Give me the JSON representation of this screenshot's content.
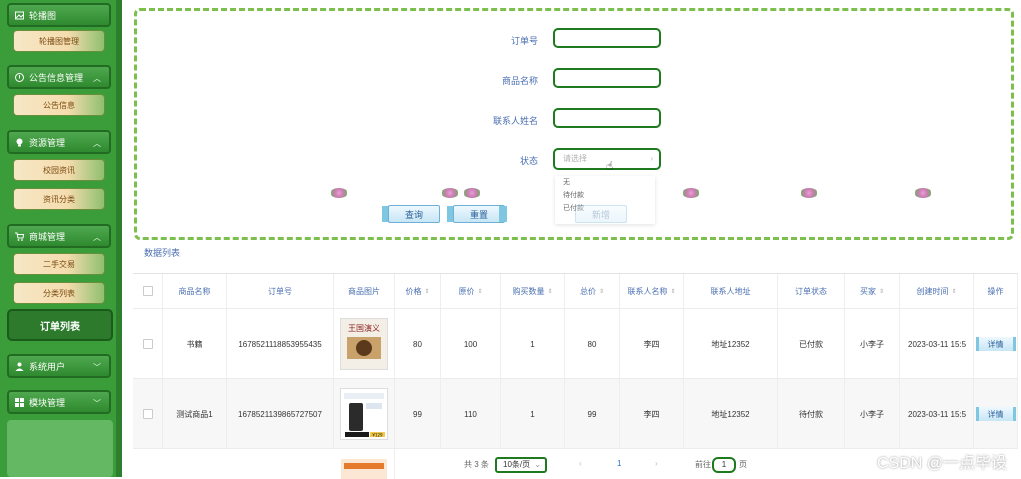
{
  "sidebar": {
    "items": [
      {
        "label": "轮播图",
        "icon": "image-icon"
      },
      {
        "label": "轮播图管理"
      },
      {
        "label": "公告信息管理",
        "icon": "info-icon"
      },
      {
        "label": "公告信息"
      },
      {
        "label": "资源管理",
        "icon": "bulb-icon"
      },
      {
        "label": "校园资讯"
      },
      {
        "label": "资讯分类"
      },
      {
        "label": "商城管理",
        "icon": "cart-icon"
      },
      {
        "label": "二手交易"
      },
      {
        "label": "分类列表"
      },
      {
        "label": "订单列表"
      },
      {
        "label": "系统用户",
        "icon": "user-icon"
      },
      {
        "label": "模块管理",
        "icon": "grid-icon"
      }
    ]
  },
  "search": {
    "order_no_label": "订单号",
    "product_name_label": "商品名称",
    "contact_name_label": "联系人姓名",
    "status_label": "状态",
    "status_placeholder": "请选择",
    "status_options": [
      "无",
      "待付款",
      "已付款"
    ],
    "query_button": "查询",
    "reset_button": "重置",
    "ghost_button": "新增"
  },
  "list": {
    "title": "数据列表",
    "headers": [
      "商品名称",
      "订单号",
      "商品图片",
      "价格",
      "原价",
      "购买数量",
      "总价",
      "联系人名称",
      "联系人地址",
      "订单状态",
      "买家",
      "创建时间",
      "操作"
    ],
    "rows": [
      {
        "name": "书籍",
        "order_no": "1678521118853955435",
        "price": "80",
        "original_price": "100",
        "qty": "1",
        "total": "80",
        "contact": "李四",
        "address": "地址12352",
        "status": "已付款",
        "buyer": "小李子",
        "created": "2023-03-11 15:5",
        "action": "详情"
      },
      {
        "name": "测试商品1",
        "order_no": "1678521139865727507",
        "price": "99",
        "original_price": "110",
        "qty": "1",
        "total": "99",
        "contact": "李四",
        "address": "地址12352",
        "status": "待付款",
        "buyer": "小李子",
        "created": "2023-03-11 15:5",
        "action": "详情"
      }
    ],
    "image_texts": [
      "王国演义",
      "¥129"
    ]
  },
  "pagination": {
    "total": "共 3 条",
    "page_size": "10条/页",
    "prev": "‹",
    "current": "1",
    "next": "›",
    "goto_prefix": "前往",
    "goto_value": "1",
    "goto_suffix": "页"
  },
  "watermark": "CSDN @一点毕设",
  "colors": {
    "sidebar": "#3a9d3a",
    "accent_green": "#1f7a1f",
    "label_blue": "#4a6fb0"
  }
}
